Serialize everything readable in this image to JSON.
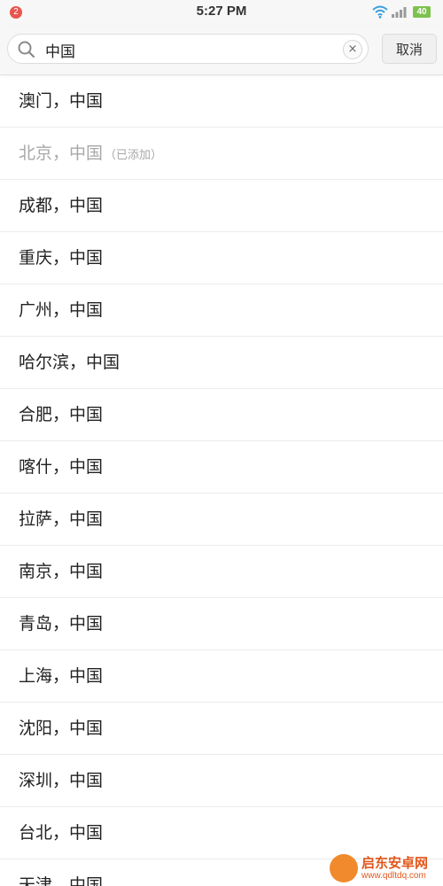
{
  "status_bar": {
    "notification_count": "2",
    "time": "5:27 PM",
    "battery": "40",
    "icons": [
      "wifi-icon",
      "signal-icon",
      "battery-icon"
    ]
  },
  "search": {
    "value": "中国",
    "clear_label": "×",
    "cancel_label": "取消"
  },
  "cities": [
    {
      "label": "澳门，中国",
      "tag": ""
    },
    {
      "label": "北京，中国",
      "tag": "（已添加）"
    },
    {
      "label": "成都，中国",
      "tag": ""
    },
    {
      "label": "重庆，中国",
      "tag": ""
    },
    {
      "label": "广州，中国",
      "tag": ""
    },
    {
      "label": "哈尔滨，中国",
      "tag": ""
    },
    {
      "label": "合肥，中国",
      "tag": ""
    },
    {
      "label": "喀什，中国",
      "tag": ""
    },
    {
      "label": "拉萨，中国",
      "tag": ""
    },
    {
      "label": "南京，中国",
      "tag": ""
    },
    {
      "label": "青岛，中国",
      "tag": ""
    },
    {
      "label": "上海，中国",
      "tag": ""
    },
    {
      "label": "沈阳，中国",
      "tag": ""
    },
    {
      "label": "深圳，中国",
      "tag": ""
    },
    {
      "label": "台北，中国",
      "tag": ""
    },
    {
      "label": "天津，中国",
      "tag": ""
    }
  ],
  "watermark": {
    "title": "启东安卓网",
    "url": "www.qdltdq.com"
  },
  "colors": {
    "badge": "#e8554d",
    "battery": "#7cc24d",
    "added_text": "#a8a8a8",
    "watermark": "#e2571c"
  }
}
